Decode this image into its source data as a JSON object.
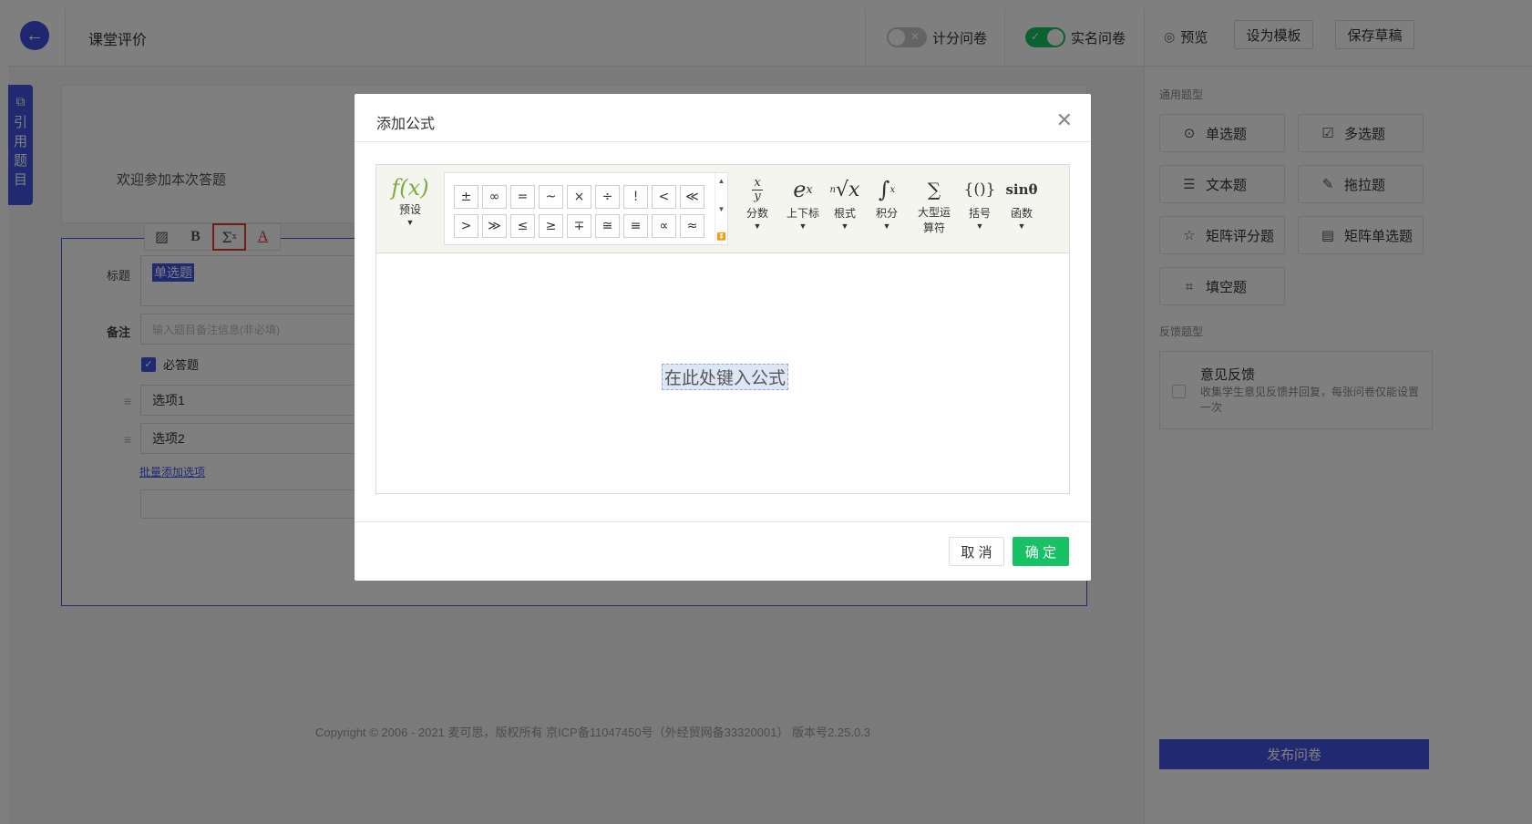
{
  "header": {
    "page_title": "课堂评价",
    "score_toggle_label": "计分问卷",
    "realname_toggle_label": "实名问卷",
    "preview_label": "预览",
    "template_label": "设为模板",
    "save_draft_label": "保存草稿"
  },
  "side_tab": {
    "label": "引用题目"
  },
  "editor": {
    "welcome_text": "欢迎参加本次答题",
    "title_label": "标题",
    "title_value": "单选题",
    "note_label": "备注",
    "note_placeholder": "输入题目备注信息(非必填)",
    "required_label": "必答题",
    "options": [
      "选项1",
      "选项2"
    ],
    "batch_add_label": "批量添加选项",
    "copyright": "Copyright © 2006 - 2021 麦可思，版权所有 京ICP备11047450号（外经贸网备33320001） 版本号2.25.0.3"
  },
  "right_panel": {
    "common_section": "通用题型",
    "types": [
      {
        "label": "单选题",
        "icon": "radio-icon"
      },
      {
        "label": "多选题",
        "icon": "checkbox-icon"
      },
      {
        "label": "文本题",
        "icon": "text-lines-icon"
      },
      {
        "label": "拖拉题",
        "icon": "edit-icon"
      },
      {
        "label": "矩阵评分题",
        "icon": "star-icon"
      },
      {
        "label": "矩阵单选题",
        "icon": "list-icon"
      },
      {
        "label": "填空题",
        "icon": "blank-icon"
      }
    ],
    "feedback_section": "反馈题型",
    "feedback_title": "意见反馈",
    "feedback_desc": "收集学生意见反馈并回复，每张问卷仅能设置一次",
    "publish_label": "发布问卷"
  },
  "dialog": {
    "title": "添加公式",
    "preset_label": "预设",
    "symbols": [
      "±",
      "∞",
      "=",
      "~",
      "×",
      "÷",
      "!",
      "<",
      "≪",
      ">",
      "≫",
      "≤",
      "≥",
      "∓",
      "≅",
      "≡",
      "∝",
      "≈"
    ],
    "tools": [
      {
        "label": "分数",
        "icon": "fraction-icon"
      },
      {
        "label": "上下标",
        "icon": "superscript-icon"
      },
      {
        "label": "根式",
        "icon": "root-icon"
      },
      {
        "label": "积分",
        "icon": "integral-icon"
      },
      {
        "label": "大型运算符",
        "icon": "sum-icon"
      },
      {
        "label": "括号",
        "icon": "bracket-icon"
      },
      {
        "label": "函数",
        "icon": "function-icon"
      }
    ],
    "placeholder": "在此处键入公式",
    "cancel_label": "取 消",
    "ok_label": "确 定"
  },
  "colors": {
    "brand": "#4355e3",
    "confirm": "#17c265",
    "toggle_on": "#17c265"
  }
}
